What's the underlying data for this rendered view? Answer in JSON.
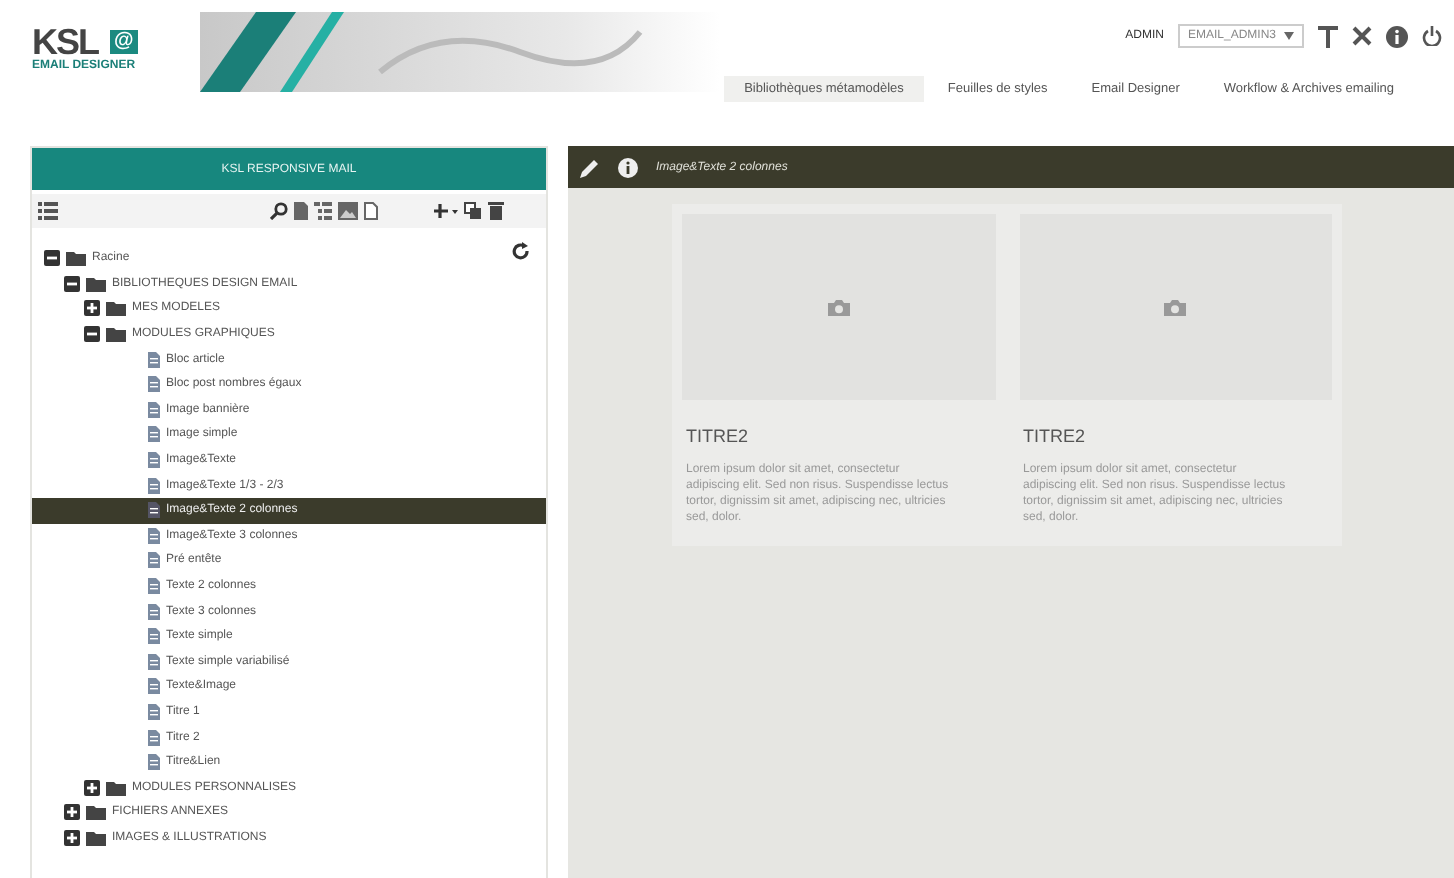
{
  "header": {
    "logo": {
      "main": "KSL",
      "badge": "@",
      "subtitle": "EMAIL DESIGNER"
    },
    "user_role": "ADMIN",
    "user_select": "EMAIL_ADMIN3",
    "nav": [
      {
        "label": "Bibliothèques métamodèles",
        "selected": true
      },
      {
        "label": "Feuilles de styles",
        "selected": false
      },
      {
        "label": "Email Designer",
        "selected": false
      },
      {
        "label": "Workflow & Archives emailing",
        "selected": false
      }
    ]
  },
  "left_panel": {
    "title": "KSL RESPONSIVE MAIL",
    "tree": [
      {
        "label": "Racine",
        "kind": "folder",
        "expanded": true,
        "selected": false,
        "children": [
          {
            "label": "BIBLIOTHEQUES DESIGN EMAIL",
            "kind": "folder",
            "expanded": true,
            "selected": false,
            "children": [
              {
                "label": "MES MODELES",
                "kind": "folder",
                "expanded": false,
                "selected": false
              },
              {
                "label": "MODULES GRAPHIQUES",
                "kind": "folder",
                "expanded": true,
                "selected": false,
                "children": [
                  {
                    "label": "Bloc article",
                    "kind": "file",
                    "selected": false
                  },
                  {
                    "label": "Bloc post nombres égaux",
                    "kind": "file",
                    "selected": false
                  },
                  {
                    "label": "Image bannière",
                    "kind": "file",
                    "selected": false
                  },
                  {
                    "label": "Image simple",
                    "kind": "file",
                    "selected": false
                  },
                  {
                    "label": "Image&Texte",
                    "kind": "file",
                    "selected": false
                  },
                  {
                    "label": "Image&Texte 1/3 - 2/3",
                    "kind": "file",
                    "selected": false
                  },
                  {
                    "label": "Image&Texte 2 colonnes",
                    "kind": "file",
                    "selected": true
                  },
                  {
                    "label": "Image&Texte 3 colonnes",
                    "kind": "file",
                    "selected": false
                  },
                  {
                    "label": "Pré entête",
                    "kind": "file",
                    "selected": false
                  },
                  {
                    "label": "Texte 2 colonnes",
                    "kind": "file",
                    "selected": false
                  },
                  {
                    "label": "Texte 3 colonnes",
                    "kind": "file",
                    "selected": false
                  },
                  {
                    "label": "Texte simple",
                    "kind": "file",
                    "selected": false
                  },
                  {
                    "label": "Texte simple variabilisé",
                    "kind": "file",
                    "selected": false
                  },
                  {
                    "label": "Texte&Image",
                    "kind": "file",
                    "selected": false
                  },
                  {
                    "label": "Titre 1",
                    "kind": "file",
                    "selected": false
                  },
                  {
                    "label": "Titre 2",
                    "kind": "file",
                    "selected": false
                  },
                  {
                    "label": "Titre&Lien",
                    "kind": "file",
                    "selected": false
                  }
                ]
              },
              {
                "label": "MODULES PERSONNALISES",
                "kind": "folder",
                "expanded": false,
                "selected": false
              }
            ]
          },
          {
            "label": "FICHIERS ANNEXES",
            "kind": "folder",
            "expanded": false,
            "selected": false
          },
          {
            "label": "IMAGES & ILLUSTRATIONS",
            "kind": "folder",
            "expanded": false,
            "selected": false
          }
        ]
      }
    ]
  },
  "right_panel": {
    "title": "Image&Texte 2 colonnes",
    "columns": [
      {
        "heading": "TITRE2",
        "text": "Lorem ipsum dolor sit amet, consectetur adipiscing elit. Sed non risus. Suspendisse lectus tortor, dignissim sit amet, adipiscing nec, ultricies sed, dolor."
      },
      {
        "heading": "TITRE2",
        "text": "Lorem ipsum dolor sit amet, consectetur adipiscing elit. Sed non risus. Suspendisse lectus tortor, dignissim sit amet, adipiscing nec, ultricies sed, dolor."
      }
    ]
  }
}
